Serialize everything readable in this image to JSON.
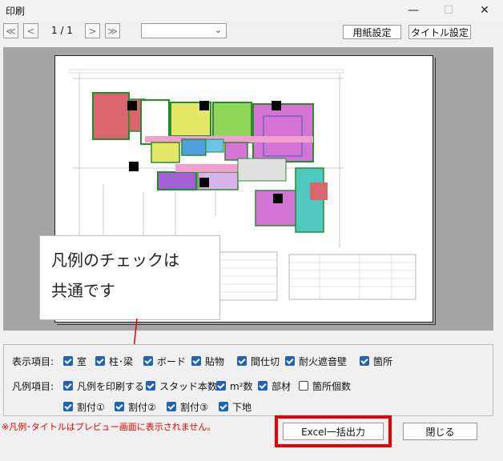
{
  "window": {
    "title": "印刷",
    "minimize": "—",
    "maximize": "☐",
    "close": "✕"
  },
  "toolbar": {
    "first_icon": "≪",
    "prev_icon": "<",
    "next_icon": ">",
    "last_icon": "≫",
    "page_info": "1 / 1",
    "combo_value": "",
    "paper_settings": "用紙設定",
    "title_settings": "タイトル設定"
  },
  "callout": {
    "line1": "凡例のチェックは",
    "line2": "共通です"
  },
  "display": {
    "label": "表示項目:",
    "items": [
      {
        "label": "室",
        "checked": true
      },
      {
        "label": "柱･梁",
        "checked": true
      },
      {
        "label": "ボード",
        "checked": true
      },
      {
        "label": "貼物",
        "checked": true
      },
      {
        "label": "間仕切",
        "checked": true
      },
      {
        "label": "耐火遮音壁",
        "checked": true
      },
      {
        "label": "箇所",
        "checked": true
      }
    ]
  },
  "legend": {
    "label": "凡例項目:",
    "items": [
      {
        "label": "凡例を印刷する",
        "checked": true
      },
      {
        "label": "スタッド本数",
        "checked": true
      },
      {
        "label": "m²数",
        "checked": true
      },
      {
        "label": "部材",
        "checked": true
      },
      {
        "label": "箇所個数",
        "checked": false
      },
      {
        "label": "割付①",
        "checked": true
      },
      {
        "label": "割付②",
        "checked": true
      },
      {
        "label": "割付③",
        "checked": true
      },
      {
        "label": "下地",
        "checked": true
      }
    ]
  },
  "note": "※凡例･タイトルはプレビュー画面に表示されません。",
  "buttons": {
    "excel": "Excel一括出力",
    "close": "閉じる"
  },
  "colors": {
    "accent_check": "#1f62b8",
    "highlight": "#e60000",
    "note_text": "#e00000"
  }
}
